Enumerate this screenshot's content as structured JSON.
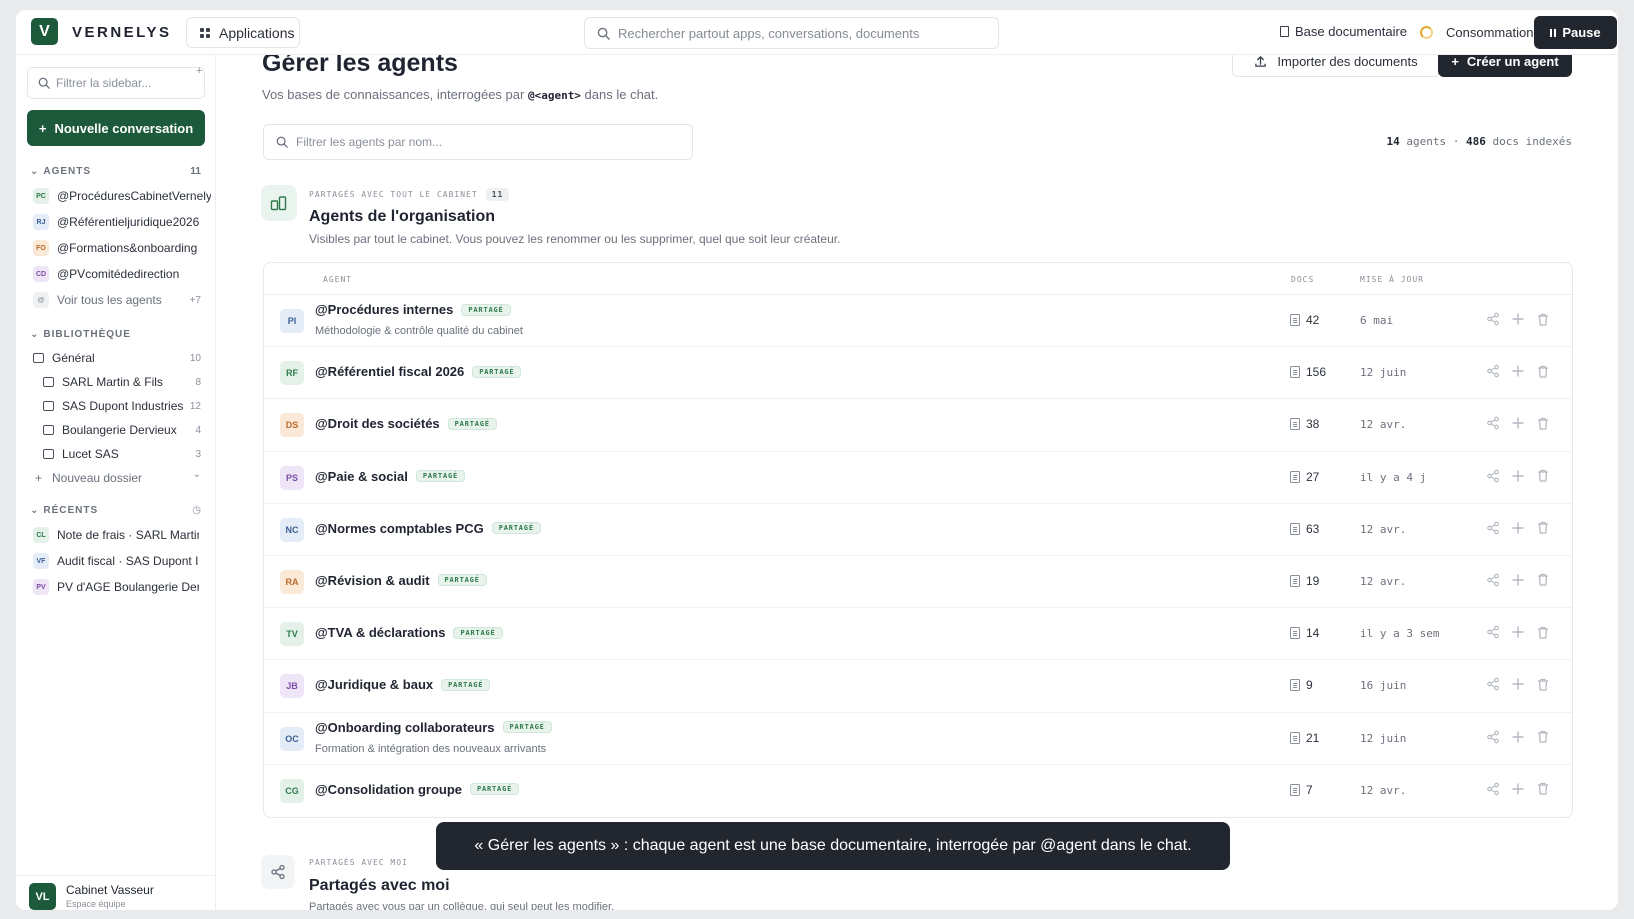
{
  "topbar": {
    "logo_letter": "V",
    "brand": "VERNELYS",
    "apps_label": "Applications",
    "search_placeholder": "Rechercher partout apps, conversations, documents",
    "base_doc_label": "Base documentaire",
    "conso_label": "Consommation",
    "pause_label": "Pause"
  },
  "sidebar": {
    "filter_placeholder": "Filtrer la sidebar...",
    "plus_label": "+",
    "new_conv_label": "Nouvelle conversation",
    "agents_section": {
      "label": "AGENTS",
      "count": "11"
    },
    "agents": [
      {
        "initials": "PC",
        "label": "@ProcéduresCabinetVernelys",
        "color": "green"
      },
      {
        "initials": "RJ",
        "label": "@Référentieljuridique2026",
        "color": "blue"
      },
      {
        "initials": "FO",
        "label": "@Formations&onboarding",
        "color": "orange"
      },
      {
        "initials": "CD",
        "label": "@PVcomitédedirection",
        "color": "purple"
      }
    ],
    "see_all": {
      "icon": "@",
      "label": "Voir tous les agents",
      "count": "+7"
    },
    "library_section": {
      "label": "BIBLIOTHÈQUE"
    },
    "folders": [
      {
        "label": "Général",
        "count": "10",
        "indent": false
      },
      {
        "label": "SARL Martin & Fils",
        "count": "8",
        "indent": true
      },
      {
        "label": "SAS Dupont Industries",
        "count": "12",
        "indent": true
      },
      {
        "label": "Boulangerie Dervieux",
        "count": "4",
        "indent": true
      },
      {
        "label": "Lucet SAS",
        "count": "3",
        "indent": true
      }
    ],
    "new_folder_label": "Nouveau dossier",
    "recent_section": {
      "label": "RÉCENTS"
    },
    "recents": [
      {
        "initials": "CL",
        "label": "Note de frais · SARL Martin & Fils",
        "color": "green"
      },
      {
        "initials": "VF",
        "label": "Audit fiscal · SAS Dupont Industries",
        "color": "blue"
      },
      {
        "initials": "PV",
        "label": "PV d'AGE Boulangerie Dervieux",
        "color": "purple"
      }
    ],
    "user": {
      "initials": "VL",
      "name": "Cabinet Vasseur",
      "subtitle": "Espace équipe"
    }
  },
  "main": {
    "title": "Gérer les agents",
    "subtitle_before": "Vos bases de connaissances, interrogées par ",
    "subtitle_code": "@<agent>",
    "subtitle_after": " dans le chat.",
    "import_label": "Importer des documents",
    "create_label": "Créer un agent",
    "filter_placeholder": "Filtrer les agents par nom...",
    "stats": {
      "agents_count": "14",
      "agents_label": "agents",
      "docs_count": "486",
      "docs_label": "docs indexés"
    },
    "org_section": {
      "kicker": "PARTAGÉS AVEC TOUT LE CABINET",
      "kicker_count": "11",
      "title": "Agents de l'organisation",
      "description": "Visibles par tout le cabinet. Vous pouvez les renommer ou les supprimer, quel que soit leur créateur."
    },
    "table_headers": {
      "agent": "AGENT",
      "docs": "DOCS",
      "updated": "MISE À JOUR"
    },
    "agents": [
      {
        "initials": "PI",
        "name": "@Procédures internes",
        "badge": "PARTAGÉ",
        "description": "Méthodologie & contrôle qualité du cabinet",
        "docs": "42",
        "date": "6 mai",
        "color": "blue"
      },
      {
        "initials": "RF",
        "name": "@Référentiel fiscal 2026",
        "badge": "PARTAGÉ",
        "description": "",
        "docs": "156",
        "date": "12 juin",
        "color": "green"
      },
      {
        "initials": "DS",
        "name": "@Droit des sociétés",
        "badge": "PARTAGÉ",
        "description": "",
        "docs": "38",
        "date": "12 avr.",
        "color": "orange"
      },
      {
        "initials": "PS",
        "name": "@Paie & social",
        "badge": "PARTAGÉ",
        "description": "",
        "docs": "27",
        "date": "il y a 4 j",
        "color": "purple"
      },
      {
        "initials": "NC",
        "name": "@Normes comptables PCG",
        "badge": "PARTAGÉ",
        "description": "",
        "docs": "63",
        "date": "12 avr.",
        "color": "blue"
      },
      {
        "initials": "RA",
        "name": "@Révision & audit",
        "badge": "PARTAGÉ",
        "description": "",
        "docs": "19",
        "date": "12 avr.",
        "color": "orange"
      },
      {
        "initials": "TV",
        "name": "@TVA & déclarations",
        "badge": "PARTAGÉ",
        "description": "",
        "docs": "14",
        "date": "il y a 3 sem",
        "color": "green"
      },
      {
        "initials": "JB",
        "name": "@Juridique & baux",
        "badge": "PARTAGÉ",
        "description": "",
        "docs": "9",
        "date": "16 juin",
        "color": "purple"
      },
      {
        "initials": "OC",
        "name": "@Onboarding collaborateurs",
        "badge": "PARTAGÉ",
        "description": "Formation & intégration des nouveaux arrivants",
        "docs": "21",
        "date": "12 juin",
        "color": "blue"
      },
      {
        "initials": "CG",
        "name": "@Consolidation groupe",
        "badge": "PARTAGÉ",
        "description": "",
        "docs": "7",
        "date": "12 avr.",
        "color": "green"
      }
    ],
    "shared_section": {
      "kicker": "PARTAGÉS AVEC MOI",
      "title": "Partagés avec moi",
      "description": "Partagés avec vous par un collègue, qui seul peut les modifier."
    },
    "toast": "« Gérer les agents » : chaque agent est une base documentaire, interrogée par @agent dans le chat."
  },
  "icons": {
    "search": "search-icon",
    "grid": "grid-icon",
    "document": "document-icon",
    "spinner": "loading-spinner-icon",
    "pause": "pause-icon",
    "upload": "upload-icon",
    "plus": "plus-icon",
    "share": "share-icon",
    "delete": "trash-icon",
    "folder": "folder-icon",
    "chevron": "chevron-down-icon",
    "clock": "clock-icon",
    "building": "building-icon"
  },
  "colors": {
    "brand_green": "#1d5a3b",
    "dark_button": "#22262e",
    "badge_green": "#2e7a4c",
    "spinner": "#e0a829"
  }
}
